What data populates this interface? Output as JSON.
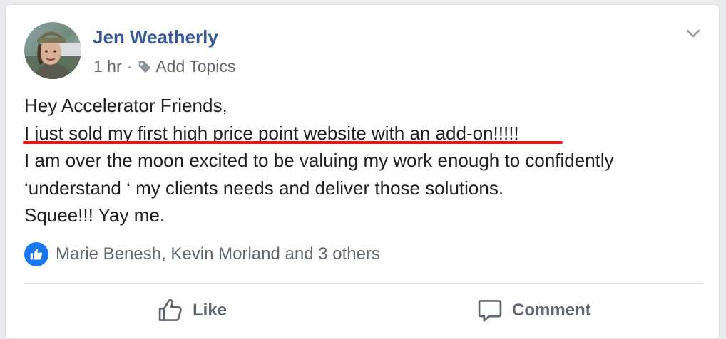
{
  "post": {
    "author": "Jen Weatherly",
    "time": "1 hr",
    "separator": "·",
    "add_topics": "Add Topics",
    "lines": [
      "Hey Accelerator Friends,",
      "I just sold my first high price point website with an add-on!!!!!",
      "I am over the moon excited to be valuing my work enough to confidently",
      "‘understand ‘ my clients needs and deliver those solutions.",
      "Squee!!! Yay me."
    ],
    "reactions_text": "Marie Benesh, Kevin Morland and 3 others"
  },
  "actions": {
    "like": "Like",
    "comment": "Comment"
  },
  "icons": {
    "tag": "tag-icon",
    "chevron": "chevron-down-icon",
    "like_badge": "thumbs-up-icon",
    "like_action": "thumbs-up-outline-icon",
    "comment_action": "speech-bubble-icon"
  },
  "colors": {
    "author_link": "#385898",
    "meta_text": "#606770",
    "body_text": "#1c1e21",
    "underline": "#e8141c",
    "like_badge": "#1877f2"
  }
}
